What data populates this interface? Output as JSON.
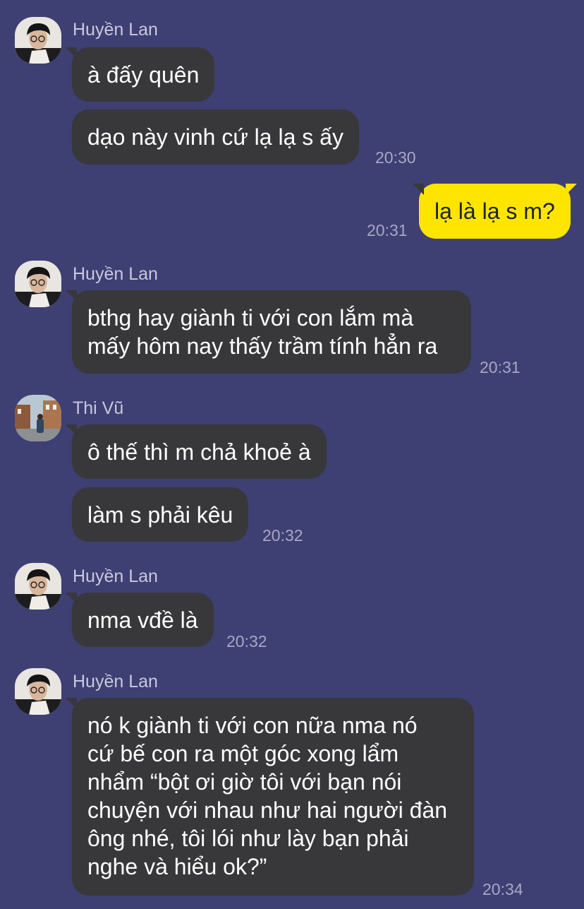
{
  "messages": {
    "g1": {
      "sender": "Huyền Lan",
      "avatar": "person-glasses-avatar",
      "m1": "à đấy quên",
      "m2": "dạo này vinh cứ lạ lạ s ấy",
      "time": "20:30"
    },
    "me1": {
      "text": "lạ là lạ s m?",
      "time": "20:31"
    },
    "g2": {
      "sender": "Huyền Lan",
      "avatar": "person-glasses-avatar",
      "line1": "bthg hay giành ti với con lắm mà",
      "line2": "mấy hôm nay thấy trầm tính hẳn ra",
      "time": "20:31"
    },
    "g3": {
      "sender": "Thi Vũ",
      "avatar": "street-photo-avatar",
      "m1": "ô thế thì m chả khoẻ à",
      "m2": "làm s phải kêu",
      "time": "20:32"
    },
    "g4": {
      "sender": "Huyền Lan",
      "avatar": "person-glasses-avatar",
      "m1": "nma vđề là",
      "time": "20:32"
    },
    "g5": {
      "sender": "Huyền Lan",
      "avatar": "person-glasses-avatar",
      "lines": [
        "nó k giành ti với con nữa nma nó",
        "cứ bế con ra một góc xong lẩm",
        "nhẩm “bột ơi giờ tôi với bạn nói",
        "chuyện với nhau như hai người đàn",
        "ông nhé, tôi lói như lày bạn phải",
        "nghe và hiểu ok?”"
      ],
      "time": "20:34"
    }
  },
  "colors": {
    "background": "#3e3f72",
    "bubble_other": "#38383a",
    "bubble_me": "#fee500"
  }
}
